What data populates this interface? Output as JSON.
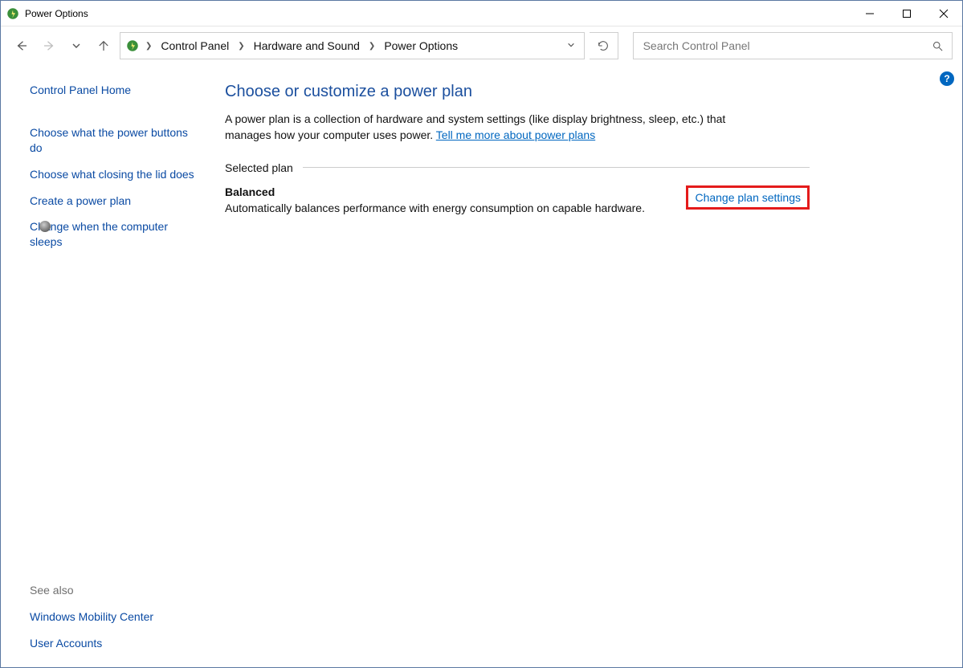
{
  "window": {
    "title": "Power Options"
  },
  "breadcrumb": {
    "items": [
      "Control Panel",
      "Hardware and Sound",
      "Power Options"
    ]
  },
  "search": {
    "placeholder": "Search Control Panel"
  },
  "sidebar": {
    "home": "Control Panel Home",
    "links": [
      "Choose what the power buttons do",
      "Choose what closing the lid does",
      "Create a power plan",
      "Change when the computer sleeps"
    ],
    "seealso_label": "See also",
    "seealso": [
      "Windows Mobility Center",
      "User Accounts"
    ]
  },
  "main": {
    "heading": "Choose or customize a power plan",
    "description": "A power plan is a collection of hardware and system settings (like display brightness, sleep, etc.) that manages how your computer uses power. ",
    "tellmemore": "Tell me more about power plans",
    "section_label": "Selected plan",
    "plan": {
      "name": "Balanced",
      "desc": "Automatically balances performance with energy consumption on capable hardware.",
      "change_label": "Change plan settings"
    }
  },
  "help_badge": "?"
}
